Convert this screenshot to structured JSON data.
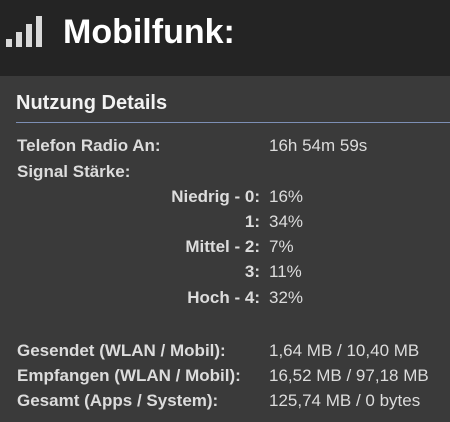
{
  "header": {
    "icon": "signal-bars-icon",
    "title": "Mobilfunk:"
  },
  "section": {
    "title": "Nutzung Details"
  },
  "radio_on": {
    "label": "Telefon Radio An:",
    "value": "16h 54m 59s"
  },
  "signal": {
    "label": "Signal Stärke:",
    "levels": [
      {
        "label": "Niedrig - 0:",
        "value": "16%"
      },
      {
        "label": "1:",
        "value": "34%"
      },
      {
        "label": "Mittel - 2:",
        "value": "7%"
      },
      {
        "label": "3:",
        "value": "11%"
      },
      {
        "label": "Hoch - 4:",
        "value": "32%"
      }
    ]
  },
  "traffic": [
    {
      "label": "Gesendet (WLAN / Mobil):",
      "value": "1,64 MB / 10,40 MB"
    },
    {
      "label": "Empfangen (WLAN / Mobil):",
      "value": "16,52 MB / 97,18 MB"
    },
    {
      "label": "Gesamt (Apps / System):",
      "value": "125,74 MB / 0 bytes"
    }
  ],
  "colors": {
    "header_bg": "#242424",
    "content_bg": "#3a3a3a",
    "divider": "#7d8fb5",
    "text": "#dcdcdc"
  }
}
